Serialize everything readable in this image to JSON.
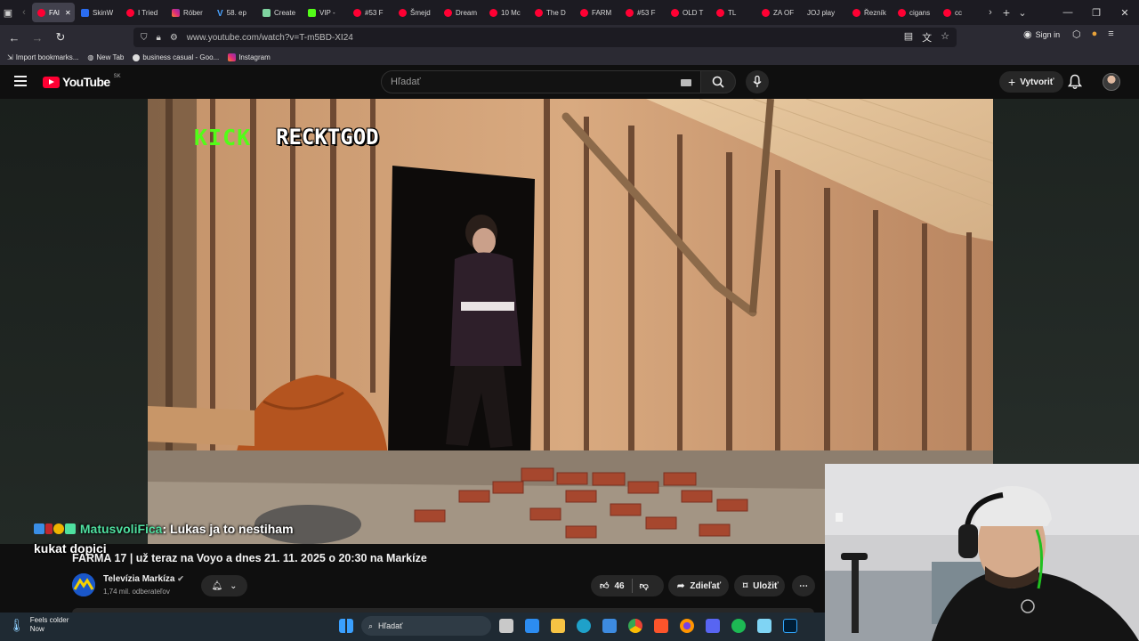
{
  "browser": {
    "tabs": [
      {
        "label": "FAI",
        "icon": "yt",
        "active": true
      },
      {
        "label": "SkinW",
        "icon": "sk"
      },
      {
        "label": "I Tried",
        "icon": "yt"
      },
      {
        "label": "Róber",
        "icon": "ig"
      },
      {
        "label": "58. ep",
        "icon": "v"
      },
      {
        "label": "Create",
        "icon": "c"
      },
      {
        "label": "VIP -",
        "icon": "k"
      },
      {
        "label": "#53 F",
        "icon": "yt"
      },
      {
        "label": "Šmejd",
        "icon": "yt"
      },
      {
        "label": "Dream",
        "icon": "yt"
      },
      {
        "label": "10 Mc",
        "icon": "yt"
      },
      {
        "label": "The D",
        "icon": "yt"
      },
      {
        "label": "FARM",
        "icon": "yt"
      },
      {
        "label": "#53 F",
        "icon": "yt"
      },
      {
        "label": "OLD T",
        "icon": "yt"
      },
      {
        "label": "TL",
        "icon": "yt"
      },
      {
        "label": "ZA OF",
        "icon": "yt"
      },
      {
        "label": "JOJ play",
        "icon": "none"
      },
      {
        "label": "Řezník",
        "icon": "yt"
      },
      {
        "label": "cigans",
        "icon": "yt"
      },
      {
        "label": "cc",
        "icon": "yt"
      }
    ],
    "url": "www.youtube.com/watch?v=T-m5BD-XI24",
    "sign_in": "Sign in",
    "bookmarks": [
      {
        "label": "Import bookmarks..."
      },
      {
        "label": "New Tab"
      },
      {
        "label": "business casual - Goo..."
      },
      {
        "label": "Instagram"
      }
    ]
  },
  "youtube": {
    "logo_word": "YouTube",
    "region": "SK",
    "search_placeholder": "Hľadať",
    "create_label": "Vytvoriť"
  },
  "video": {
    "overlay_brand": "KICK",
    "overlay_name": "RECKTGOD"
  },
  "chat": {
    "user": "MatusvoliFica",
    "message": ": Lukas ja to nestiham kukat dopici"
  },
  "meta": {
    "title": "FARMA 17 | už teraz na Voyo a dnes 21. 11. 2025 o 20:30 na Markíze",
    "channel": "Televízia Markíza",
    "subscribers": "1,74 mil. odberateľov",
    "likes": "46",
    "share_label": "Zdieľať",
    "save_label": "Uložiť"
  },
  "taskbar": {
    "weather_line1": "Feels colder",
    "weather_line2": "Now",
    "search_placeholder": "Hľadať"
  },
  "colors": {
    "kick_green": "#53fc18",
    "yt_red": "#ff0033",
    "chat_user": "#4fe0a0"
  }
}
